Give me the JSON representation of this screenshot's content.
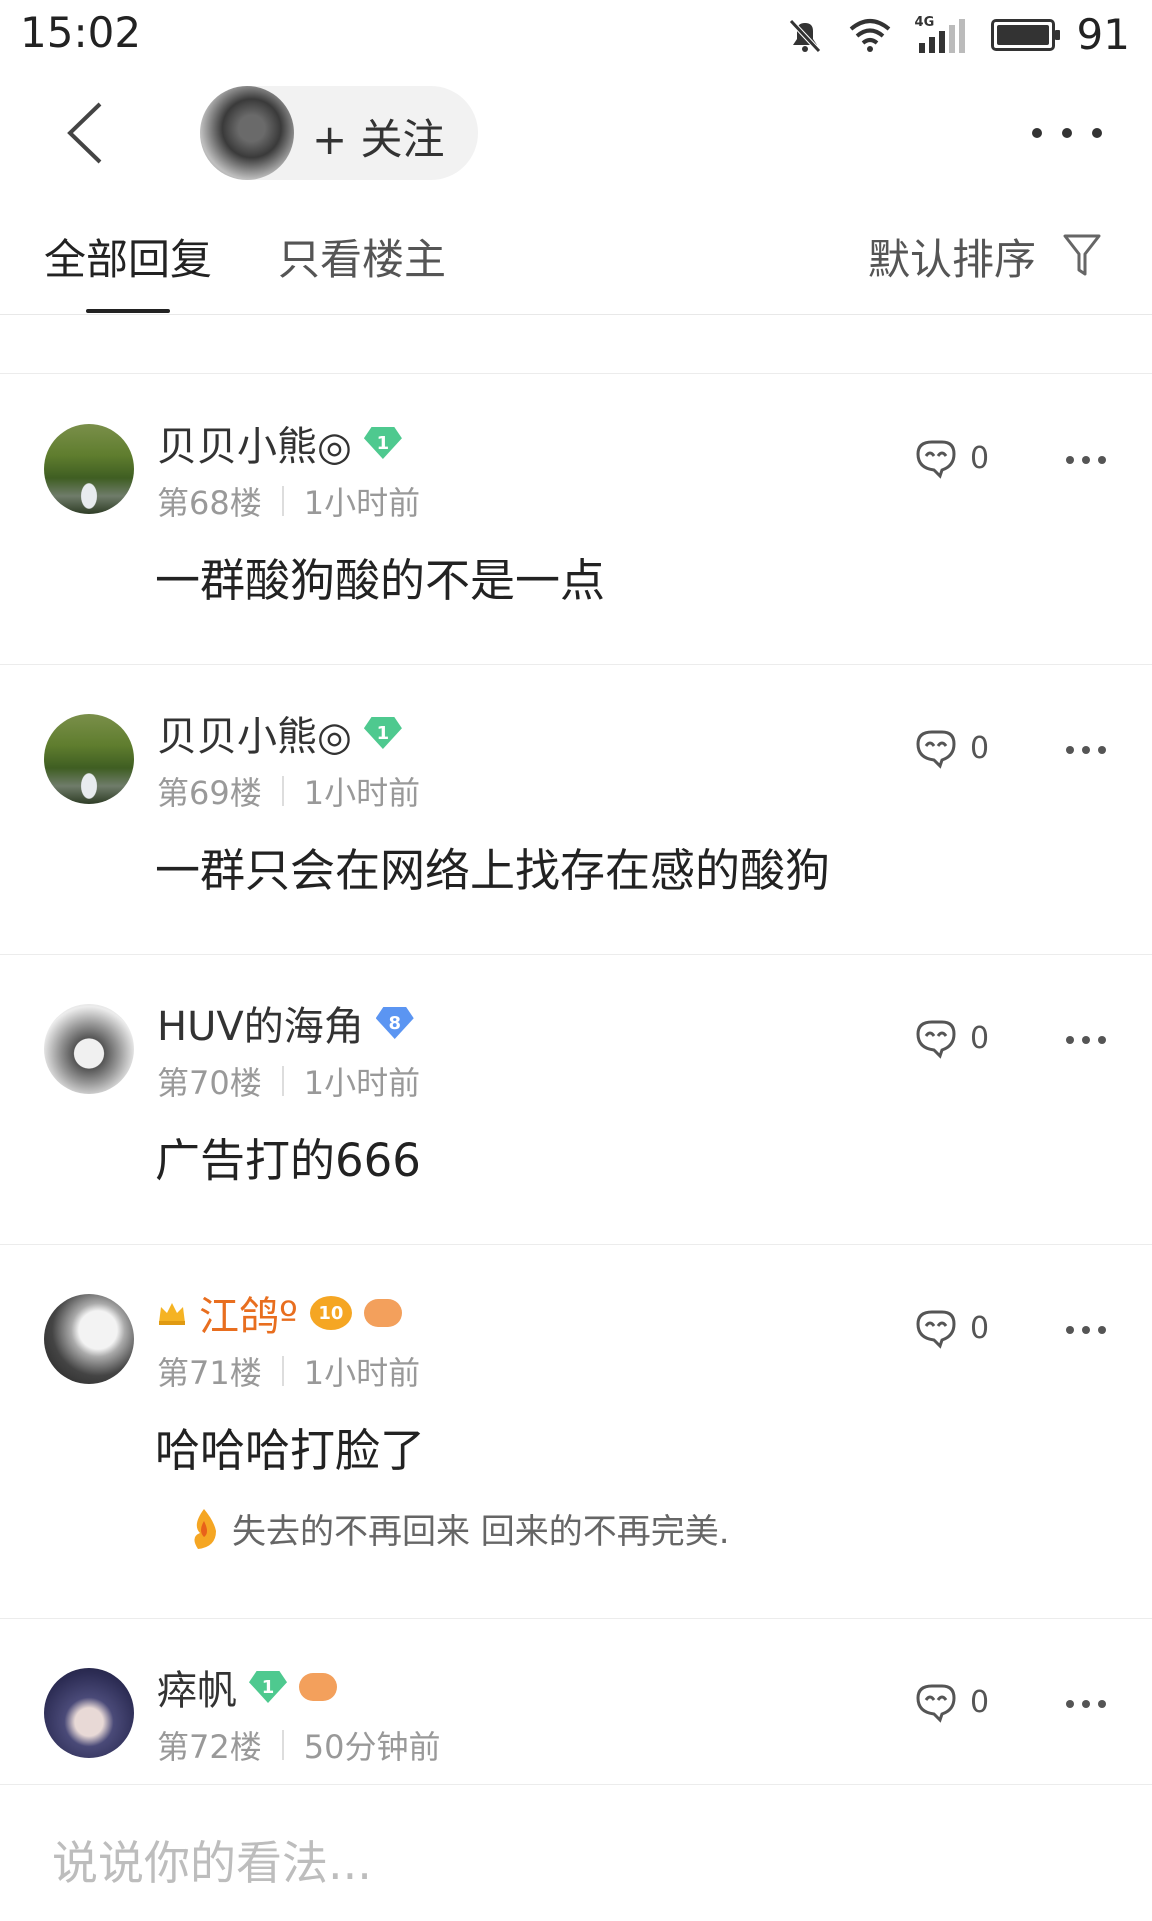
{
  "status_bar": {
    "time": "15:02",
    "network_label": "4G",
    "battery": "91"
  },
  "nav": {
    "follow_label": "+ 关注"
  },
  "tabs": {
    "all": "全部回复",
    "owner_only": "只看楼主",
    "sort": "默认排序"
  },
  "posts": [
    {
      "name": "贝贝小熊◎",
      "level": "1",
      "floor": "第68楼",
      "time": "1小时前",
      "content": "一群酸狗酸的不是一点",
      "likes": "0"
    },
    {
      "name": "贝贝小熊◎",
      "level": "1",
      "floor": "第69楼",
      "time": "1小时前",
      "content": "一群只会在网络上找存在感的酸狗",
      "likes": "0"
    },
    {
      "name": "HUV的海角",
      "level": "8",
      "floor": "第70楼",
      "time": "1小时前",
      "content": "广告打的666",
      "likes": "0"
    },
    {
      "name": "江鸽º",
      "level": "10",
      "floor": "第71楼",
      "time": "1小时前",
      "content": "哈哈哈打脸了",
      "signature": "失去的不再回来 回来的不再完美.",
      "likes": "0"
    },
    {
      "name": "瘁帆",
      "level": "1",
      "floor": "第72楼",
      "time": "50分钟前",
      "likes": "0"
    }
  ],
  "input": {
    "placeholder": "说说你的看法..."
  },
  "colors": {
    "vip_name": "#e86e1f",
    "level_green": "#4ec98f",
    "level_blue": "#5b95f2"
  }
}
